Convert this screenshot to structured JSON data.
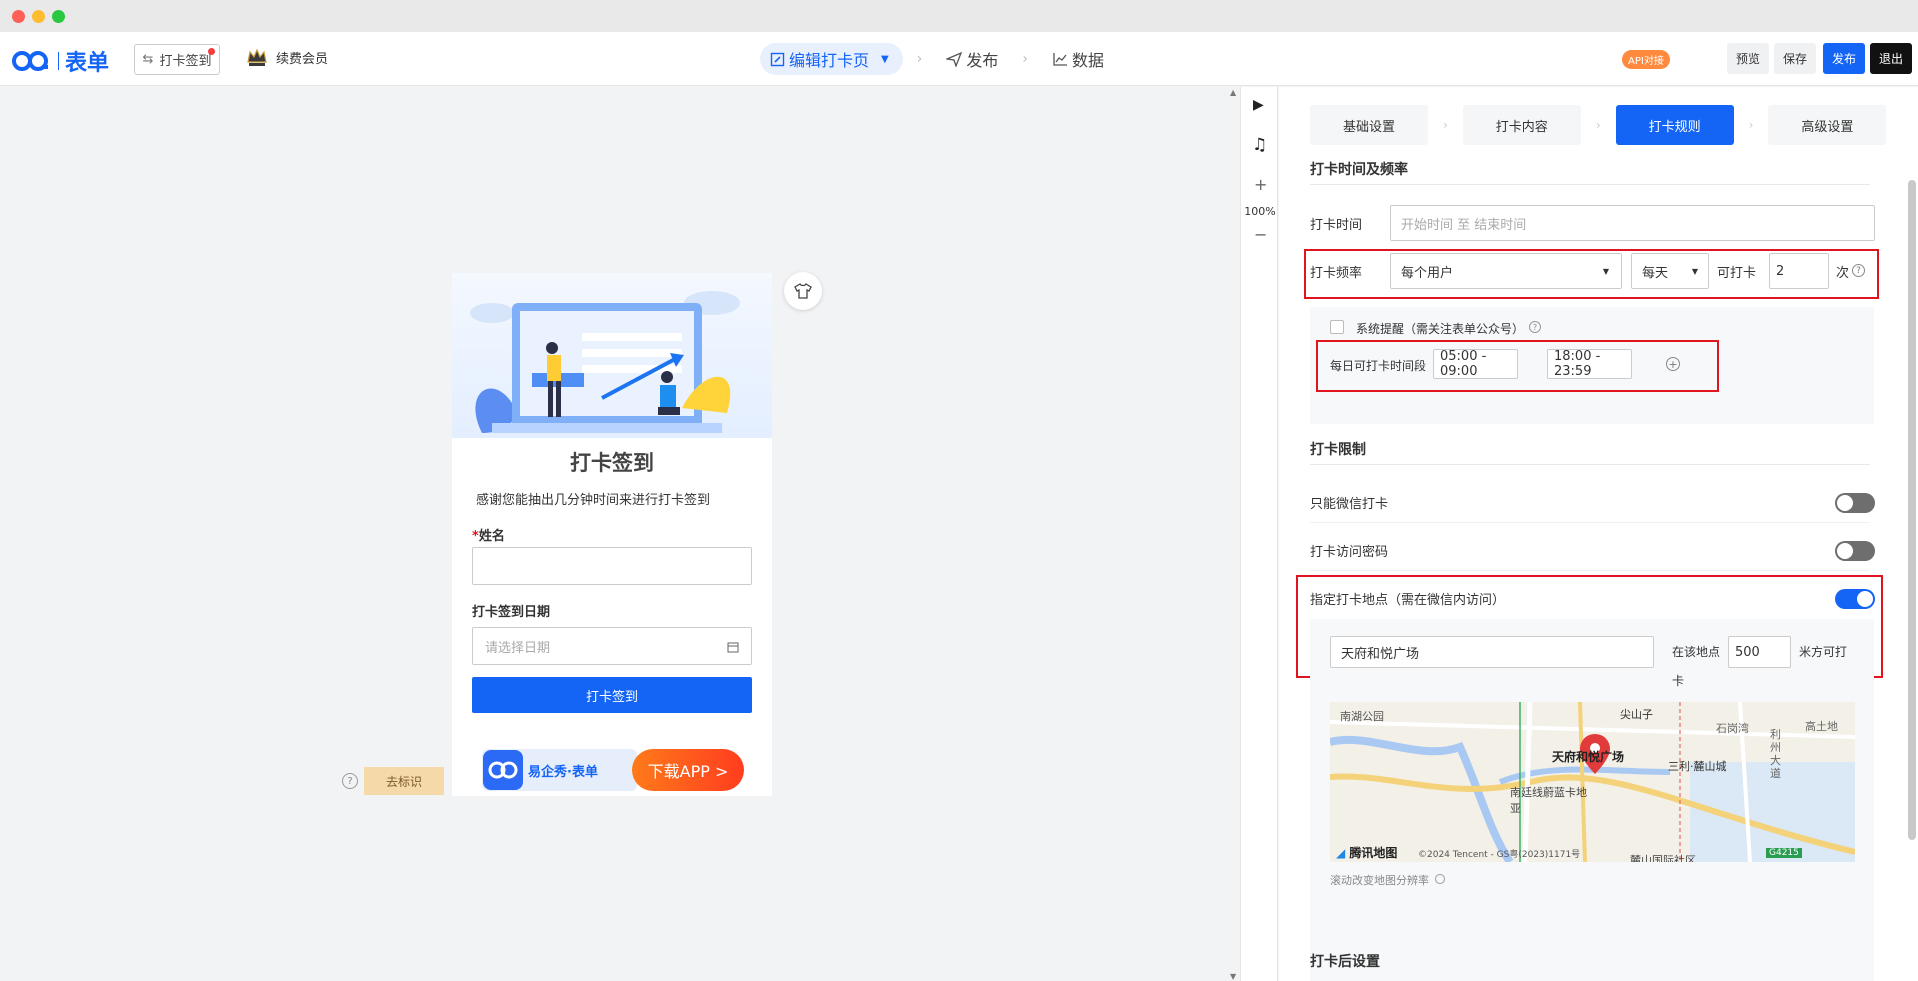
{
  "header": {
    "logo_text": "表单",
    "switch_label": "打卡签到",
    "vip_label": "续费会员",
    "steps": [
      {
        "label": "编辑打卡页"
      },
      {
        "label": "发布"
      },
      {
        "label": "数据"
      }
    ],
    "api_badge": "API对接",
    "buttons": {
      "preview": "预览",
      "save": "保存",
      "publish": "发布",
      "exit": "退出"
    }
  },
  "toolstrip": {
    "zoom": "100%",
    "plus": "+",
    "minus": "−"
  },
  "phone": {
    "title": "打卡签到",
    "desc": "感谢您能抽出几分钟时间来进行打卡签到",
    "name_label": "姓名",
    "required_mark": "*",
    "date_label": "打卡签到日期",
    "date_placeholder": "请选择日期",
    "submit": "打卡签到",
    "ad_brand": "易企秀·表单",
    "ad_cta": "下载APP >"
  },
  "remove_tag": "去标识",
  "panel": {
    "tabs": [
      {
        "label": "基础设置"
      },
      {
        "label": "打卡内容"
      },
      {
        "label": "打卡规则"
      },
      {
        "label": "高级设置"
      }
    ],
    "time_section": "打卡时间及频率",
    "checkin_time_label": "打卡时间",
    "checkin_time_placeholder": "开始时间 至 结束时间",
    "freq_label": "打卡频率",
    "freq_scope": "每个用户",
    "freq_period": "每天",
    "freq_can": "可打卡",
    "freq_count": "2",
    "freq_unit": "次",
    "reminder_label": "系统提醒（需关注表单公众号）",
    "daily_window_label": "每日可打卡时间段",
    "window_1": "05:00 - 09:00",
    "window_2": "18:00 - 23:59",
    "limit_section": "打卡限制",
    "wechat_only_label": "只能微信打卡",
    "password_label": "打卡访问密码",
    "location_label": "指定打卡地点（需在微信内访问）",
    "location_value": "天府和悦广场",
    "location_near": "在该地点",
    "radius": "500",
    "radius_unit": "米方可打",
    "radius_unit_tail": "卡",
    "map_hint": "滚动改变地图分辨率",
    "after_section": "打卡后设置",
    "map": {
      "labels": [
        "南湖公园",
        "尖山子",
        "石岗湾",
        "高土地",
        "天府和悦广场",
        "三利·麓山城",
        "南廷线蔚蓝卡地亚",
        "麓山国际社区",
        "利州大道"
      ],
      "brand": "腾讯地图",
      "copyright": "©2024 Tencent - GS粤(2023)1171号",
      "road_tag": "G4215"
    }
  },
  "colors": {
    "accent": "#1464f5",
    "highlight": "#e0141e"
  }
}
